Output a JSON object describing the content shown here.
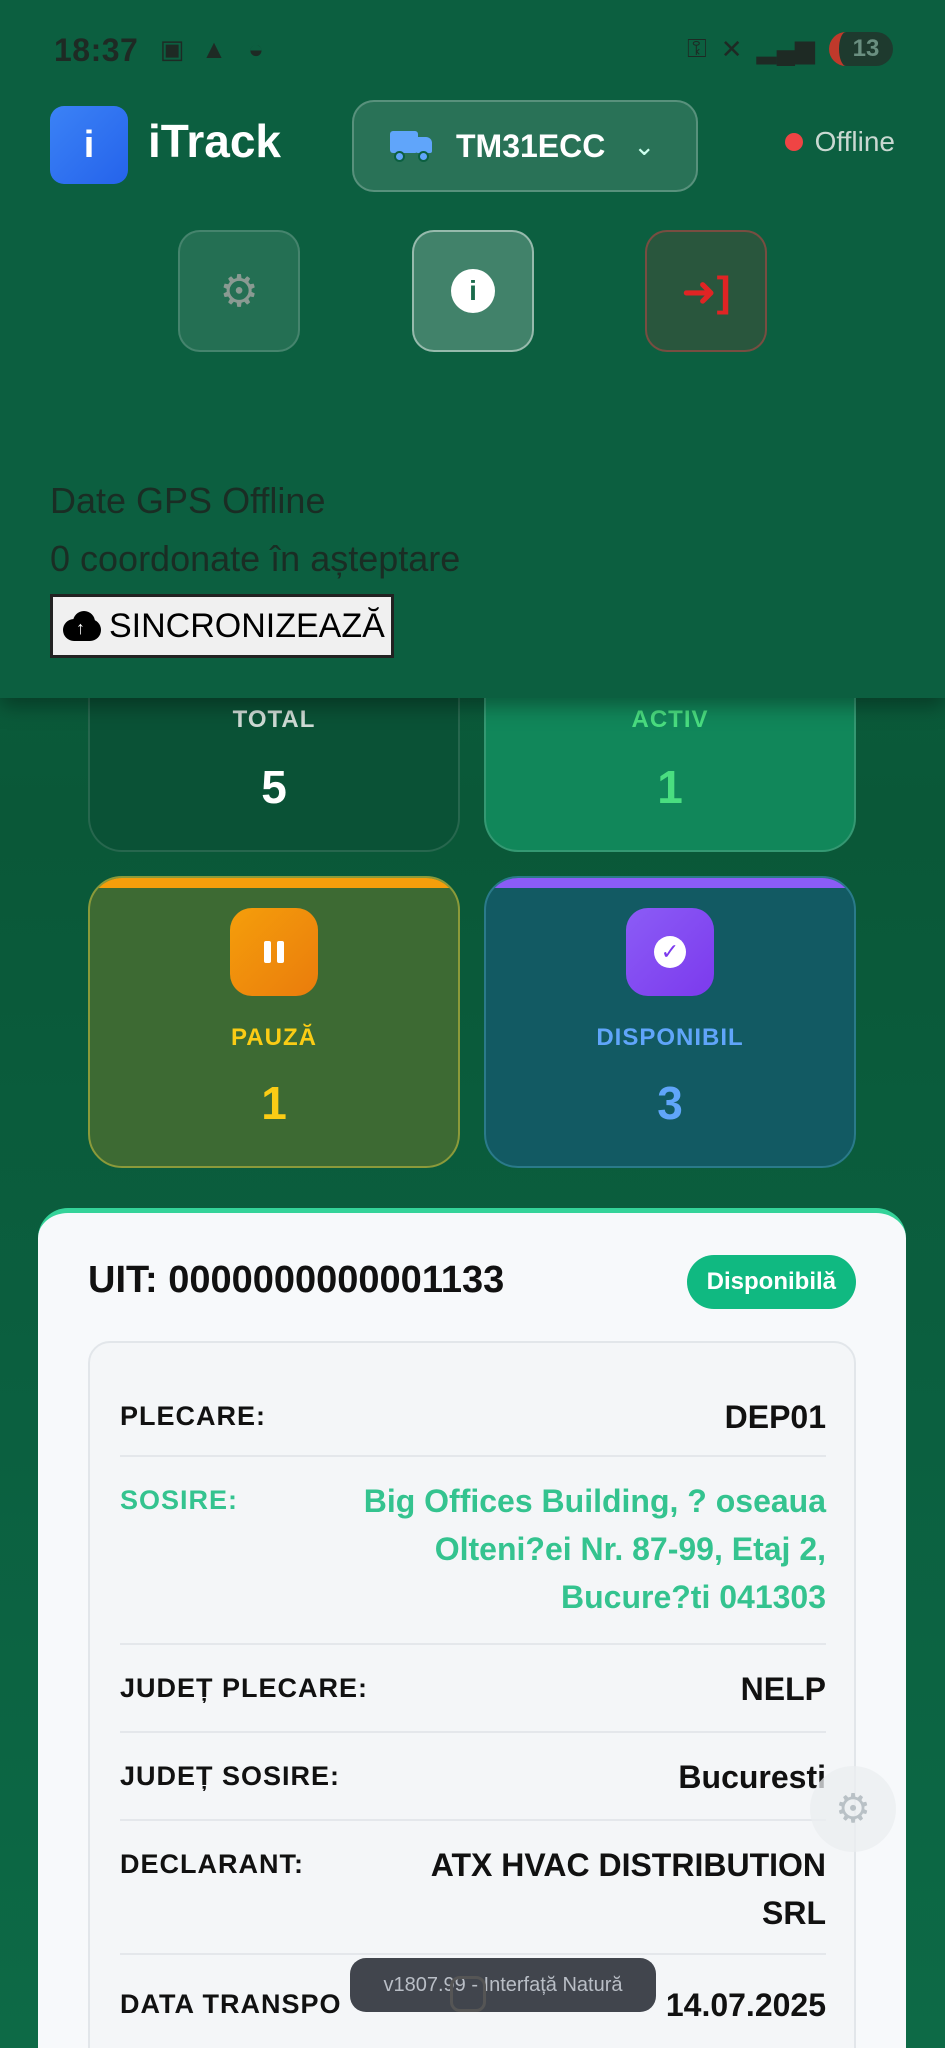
{
  "statusbar": {
    "time": "18:37",
    "battery": "13"
  },
  "header": {
    "app_name": "iTrack",
    "logo_letter": "i",
    "vehicle": "TM31ECC",
    "connection_status": "Offline",
    "colors": {
      "offline": "#ef4444",
      "accent": "#3b82f6"
    }
  },
  "gps": {
    "title": "Date GPS Offline",
    "pending": "0 coordonate în așteptare",
    "sync_label": "SINCRONIZEAZĂ"
  },
  "stats": {
    "total": {
      "label": "TOTAL",
      "value": "5"
    },
    "activ": {
      "label": "ACTIV",
      "value": "1"
    },
    "pauza": {
      "label": "PAUZĂ",
      "value": "1"
    },
    "disponibil": {
      "label": "DISPONIBIL",
      "value": "3"
    }
  },
  "course": {
    "uit": "UIT: 0000000000001133",
    "status_badge": "Disponibilă",
    "rows": [
      {
        "key": "PLECARE:",
        "value": "DEP01"
      },
      {
        "key": "SOSIRE:",
        "value": "Big Offices Building, ? oseaua Olteni?ei Nr. 87-99, Etaj 2, Bucure?ti 041303"
      },
      {
        "key": "JUDEȚ PLECARE:",
        "value": "NELP"
      },
      {
        "key": "JUDEȚ SOSIRE:",
        "value": "Bucuresti"
      },
      {
        "key": "DECLARANT:",
        "value": "ATX HVAC DISTRIBUTION SRL"
      },
      {
        "key": "DATA TRANSPO",
        "value": "14.07.2025"
      }
    ]
  },
  "toast": "v1807.99 - Interfață Natură"
}
